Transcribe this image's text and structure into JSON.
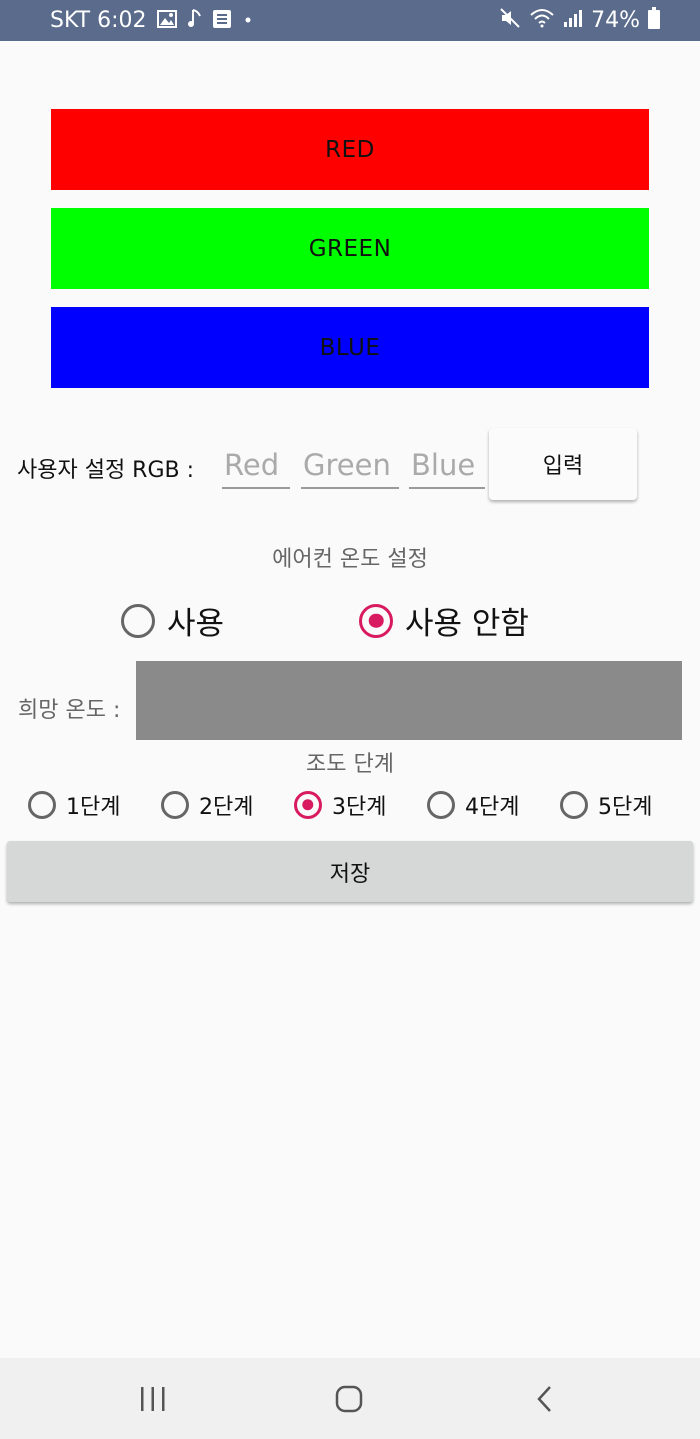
{
  "status_bar": {
    "carrier_time": "SKT 6:02",
    "battery": "74%",
    "left_icons": [
      "gallery-icon",
      "music-note-icon",
      "notes-icon",
      "dot-icon"
    ],
    "right_icons": [
      "mute-icon",
      "wifi-icon",
      "signal-icon",
      "battery-icon"
    ]
  },
  "color_buttons": {
    "red": {
      "label": "RED",
      "color": "#ff0000"
    },
    "green": {
      "label": "GREEN",
      "color": "#00ff00"
    },
    "blue": {
      "label": "BLUE",
      "color": "#0000ff"
    }
  },
  "rgb": {
    "label": "사용자 설정 RGB :",
    "red_placeholder": "Red",
    "green_placeholder": "Green",
    "blue_placeholder": "Blue",
    "enter_label": "입력"
  },
  "aircon": {
    "title": "에어컨 온도 설정",
    "options": [
      {
        "label": "사용",
        "checked": false
      },
      {
        "label": "사용 안함",
        "checked": true
      }
    ]
  },
  "hope_temp": {
    "label": "희망 온도 :"
  },
  "light": {
    "title": "조도 단계",
    "steps": [
      {
        "label": "1단계",
        "checked": false
      },
      {
        "label": "2단계",
        "checked": false
      },
      {
        "label": "3단계",
        "checked": true
      },
      {
        "label": "4단계",
        "checked": false
      },
      {
        "label": "5단계",
        "checked": false
      }
    ]
  },
  "save_label": "저장",
  "accent_color": "#d81b60",
  "nav": [
    "recent-apps-icon",
    "home-icon",
    "back-icon"
  ]
}
